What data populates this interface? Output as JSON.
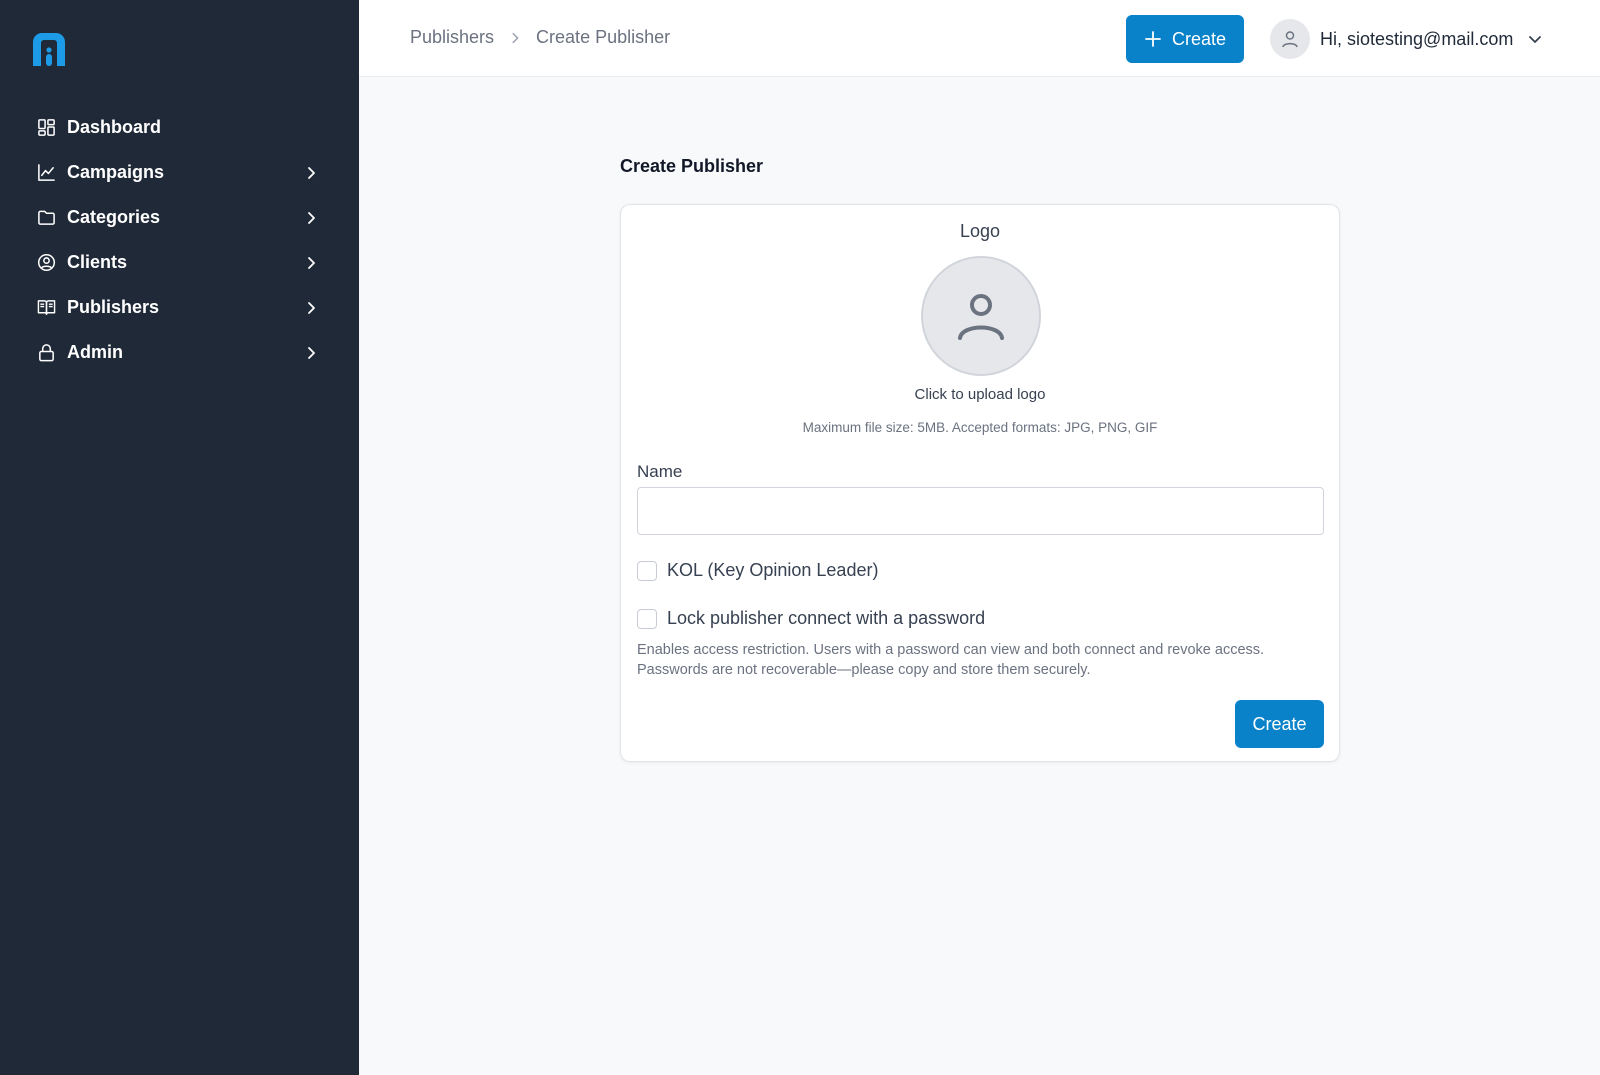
{
  "brand": {
    "logo_icon": "brand-logo-icon",
    "accent": "#0a82c9",
    "sidebar_bg": "#1f2937"
  },
  "sidebar": {
    "items": [
      {
        "label": "Dashboard",
        "icon": "dashboard-icon",
        "has_submenu": false
      },
      {
        "label": "Campaigns",
        "icon": "chart-line-icon",
        "has_submenu": true
      },
      {
        "label": "Categories",
        "icon": "folder-icon",
        "has_submenu": true
      },
      {
        "label": "Clients",
        "icon": "user-circle-icon",
        "has_submenu": true
      },
      {
        "label": "Publishers",
        "icon": "book-open-icon",
        "has_submenu": true
      },
      {
        "label": "Admin",
        "icon": "lock-icon",
        "has_submenu": true
      }
    ]
  },
  "header": {
    "breadcrumb": [
      "Publishers",
      "Create Publisher"
    ],
    "create_label": "Create",
    "user_greeting": "Hi, siotesting@mail.com"
  },
  "main": {
    "title": "Create Publisher",
    "form": {
      "logo_label": "Logo",
      "upload_label": "Click to upload logo",
      "upload_hint": "Maximum file size: 5MB. Accepted formats: JPG, PNG, GIF",
      "name_label": "Name",
      "name_value": "",
      "kol_label": "KOL (Key Opinion Leader)",
      "kol_checked": false,
      "lock_label": "Lock publisher connect with a password",
      "lock_checked": false,
      "lock_help": "Enables access restriction. Users with a password can view and both connect and revoke access. Passwords are not recoverable—please copy and store them securely.",
      "submit_label": "Create"
    }
  }
}
